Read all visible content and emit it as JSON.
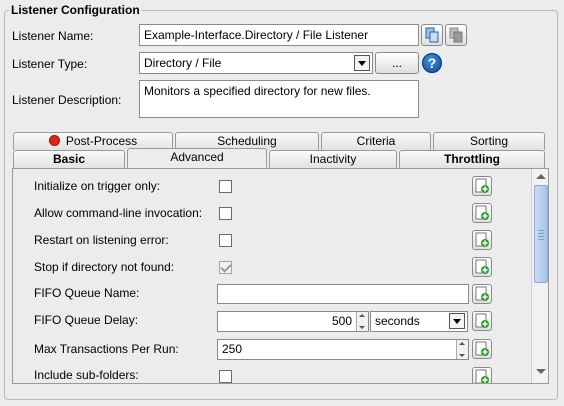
{
  "group_title": "Listener Configuration",
  "form": {
    "name_label": "Listener Name:",
    "name_value": "Example-Interface.Directory / File Listener",
    "type_label": "Listener Type:",
    "type_value": "Directory / File",
    "browse_label": "...",
    "help_label": "?",
    "desc_label": "Listener Description:",
    "desc_value": "Monitors a specified directory for new files."
  },
  "tabs_back": [
    {
      "label": "Post-Process",
      "status": "error"
    },
    {
      "label": "Scheduling"
    },
    {
      "label": "Criteria"
    },
    {
      "label": "Sorting"
    }
  ],
  "tabs_front": [
    {
      "label": "Basic"
    },
    {
      "label": "Advanced",
      "active": true
    },
    {
      "label": "Inactivity"
    },
    {
      "label": "Throttling"
    }
  ],
  "advanced": {
    "init_trigger_label": "Initialize on trigger only:",
    "init_trigger_checked": false,
    "cmdline_label": "Allow command-line invocation:",
    "cmdline_checked": false,
    "restart_label": "Restart on listening error:",
    "restart_checked": false,
    "stop_label": "Stop if directory not found:",
    "stop_checked": true,
    "fifo_name_label": "FIFO Queue Name:",
    "fifo_name_value": "",
    "fifo_delay_label": "FIFO Queue Delay:",
    "fifo_delay_value": "500",
    "fifo_delay_unit": "seconds",
    "max_tx_label": "Max Transactions Per Run:",
    "max_tx_value": "250",
    "subfolders_label": "Include sub-folders:",
    "subfolders_checked": false
  },
  "colors": {
    "error_dot": "#e2231a",
    "scroll_thumb": "#b3cdee",
    "add_icon_green": "#2e9c2e"
  }
}
